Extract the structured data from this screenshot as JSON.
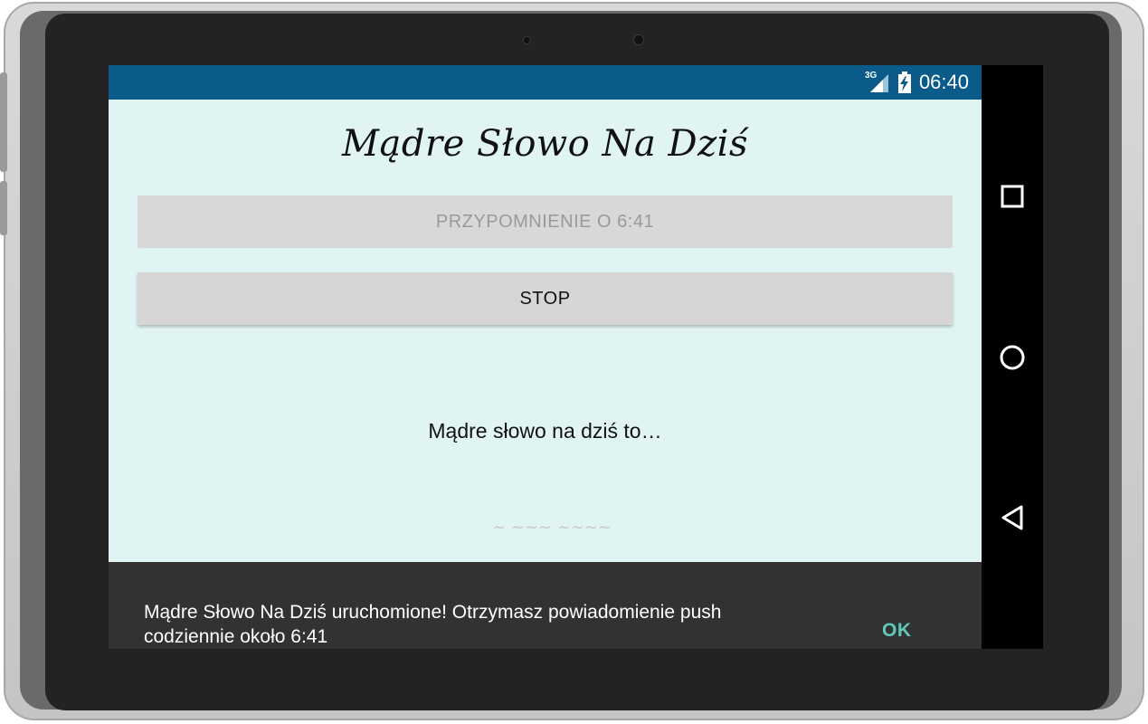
{
  "status_bar": {
    "network_type": "3G",
    "network_icon": "signal-icon",
    "battery_icon": "battery-charging-icon",
    "time": "06:40",
    "color": "#0a5a8a"
  },
  "app": {
    "title": "Mądre Słowo Na Dziś",
    "background_color": "#e0f4f3",
    "reminder_button_label": "PRZYPOMNIENIE O 6:41",
    "stop_button_label": "STOP",
    "quote_text": "Mądre słowo na dziś to…"
  },
  "snackbar": {
    "message": "Mądre Słowo Na Dziś uruchomione! Otrzymasz powiadomienie push codziennie około 6:41",
    "action_label": "OK",
    "action_color": "#5fc9bb"
  },
  "nav_bar": {
    "recents_icon": "square-icon",
    "home_icon": "circle-icon",
    "back_icon": "triangle-back-icon"
  }
}
